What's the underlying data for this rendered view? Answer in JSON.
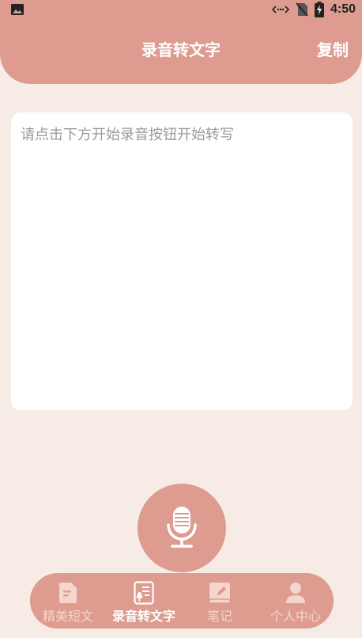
{
  "status_bar": {
    "time": "4:50",
    "icons": [
      "image-icon",
      "data-arrows-icon",
      "no-sim-icon",
      "battery-charging-icon"
    ]
  },
  "header": {
    "title": "录音转文字",
    "copy_label": "复制"
  },
  "transcript": {
    "value": "",
    "placeholder": "请点击下方开始录音按钮开始转写"
  },
  "record_button": {
    "icon": "microphone-icon"
  },
  "tabs": [
    {
      "label": "精美短文",
      "icon": "document-icon",
      "active": false
    },
    {
      "label": "录音转文字",
      "icon": "transcribe-icon",
      "active": true
    },
    {
      "label": "笔记",
      "icon": "notebook-icon",
      "active": false
    },
    {
      "label": "个人中心",
      "icon": "user-icon",
      "active": false
    }
  ],
  "colors": {
    "accent": "#dd9c8f",
    "background": "#f7ece5",
    "card": "#ffffff",
    "tab_inactive": "#f4d6cf"
  }
}
